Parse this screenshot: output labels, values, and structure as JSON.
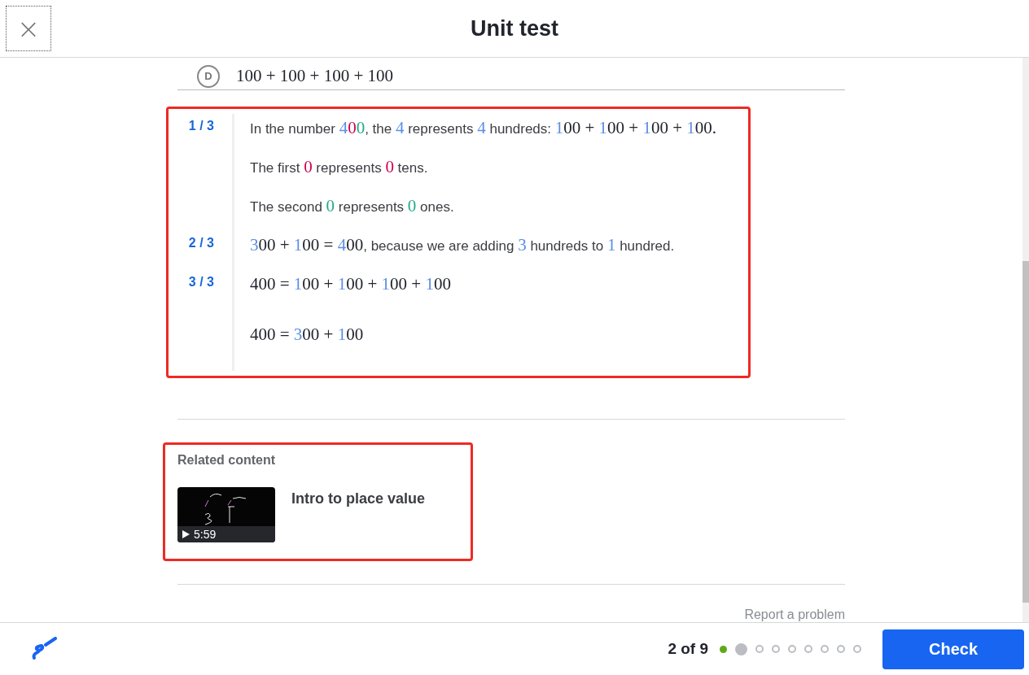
{
  "header": {
    "title": "Unit test",
    "close_button": "×"
  },
  "answer_option": {
    "letter": "D",
    "text": "100 + 100 + 100 + 100"
  },
  "hints": {
    "highlighted": true,
    "steps": [
      {
        "label": "1 / 3",
        "paragraphs": [
          [
            {
              "kind": "prose",
              "text": "In the number "
            },
            {
              "kind": "math",
              "text": "4",
              "color": "#5b8ee6"
            },
            {
              "kind": "math",
              "text": "0",
              "color": "#d1004c"
            },
            {
              "kind": "math",
              "text": "0",
              "color": "#1fab89"
            },
            {
              "kind": "prose",
              "text": ", the "
            },
            {
              "kind": "math",
              "text": "4",
              "color": "#5b8ee6"
            },
            {
              "kind": "prose",
              "text": " represents "
            },
            {
              "kind": "math",
              "text": "4",
              "color": "#5b8ee6"
            },
            {
              "kind": "prose",
              "text": " hundreds: "
            },
            {
              "kind": "math",
              "text": "1",
              "color": "#5b8ee6"
            },
            {
              "kind": "math",
              "text": "00 + "
            },
            {
              "kind": "math",
              "text": "1",
              "color": "#5b8ee6"
            },
            {
              "kind": "math",
              "text": "00 + "
            },
            {
              "kind": "math",
              "text": "1",
              "color": "#5b8ee6"
            },
            {
              "kind": "math",
              "text": "00 + "
            },
            {
              "kind": "math",
              "text": "1",
              "color": "#5b8ee6"
            },
            {
              "kind": "math",
              "text": "00."
            }
          ],
          [
            {
              "kind": "prose",
              "text": "The first "
            },
            {
              "kind": "math",
              "text": "0",
              "color": "#d1004c"
            },
            {
              "kind": "prose",
              "text": " represents "
            },
            {
              "kind": "math",
              "text": "0",
              "color": "#d1004c"
            },
            {
              "kind": "prose",
              "text": " tens."
            }
          ],
          [
            {
              "kind": "prose",
              "text": "The second "
            },
            {
              "kind": "math",
              "text": "0",
              "color": "#1fab89"
            },
            {
              "kind": "prose",
              "text": " represents "
            },
            {
              "kind": "math",
              "text": "0",
              "color": "#1fab89"
            },
            {
              "kind": "prose",
              "text": " ones."
            }
          ]
        ]
      },
      {
        "label": "2 / 3",
        "paragraphs": [
          [
            {
              "kind": "math",
              "text": "3",
              "color": "#5b8ee6"
            },
            {
              "kind": "math",
              "text": "00 + "
            },
            {
              "kind": "math",
              "text": "1",
              "color": "#5b8ee6"
            },
            {
              "kind": "math",
              "text": "00 = "
            },
            {
              "kind": "math",
              "text": "4",
              "color": "#5b8ee6"
            },
            {
              "kind": "math",
              "text": "00"
            },
            {
              "kind": "prose",
              "text": ", because we are adding "
            },
            {
              "kind": "math",
              "text": "3",
              "color": "#5b8ee6"
            },
            {
              "kind": "prose",
              "text": " hundreds to "
            },
            {
              "kind": "math",
              "text": "1",
              "color": "#5b8ee6"
            },
            {
              "kind": "prose",
              "text": " hundred."
            }
          ]
        ]
      },
      {
        "label": "3 / 3",
        "paragraphs": [
          [
            {
              "kind": "math",
              "text": "400 = "
            },
            {
              "kind": "math",
              "text": "1",
              "color": "#5b8ee6"
            },
            {
              "kind": "math",
              "text": "00 + "
            },
            {
              "kind": "math",
              "text": "1",
              "color": "#5b8ee6"
            },
            {
              "kind": "math",
              "text": "00 + "
            },
            {
              "kind": "math",
              "text": "1",
              "color": "#5b8ee6"
            },
            {
              "kind": "math",
              "text": "00 + "
            },
            {
              "kind": "math",
              "text": "1",
              "color": "#5b8ee6"
            },
            {
              "kind": "math",
              "text": "00"
            }
          ],
          [
            {
              "kind": "math",
              "text": "400 = "
            },
            {
              "kind": "math",
              "text": "3",
              "color": "#5b8ee6"
            },
            {
              "kind": "math",
              "text": "00 + "
            },
            {
              "kind": "math",
              "text": "1",
              "color": "#5b8ee6"
            },
            {
              "kind": "math",
              "text": "00"
            }
          ]
        ]
      }
    ]
  },
  "related_content": {
    "highlighted": true,
    "heading": "Related content",
    "items": [
      {
        "title": "Intro to place value",
        "duration": "5:59"
      }
    ]
  },
  "report_link": "Report a problem",
  "footer": {
    "progress_text": "2 of 9",
    "dots": [
      {
        "kind": "done"
      },
      {
        "kind": "current"
      },
      {
        "kind": "pending"
      },
      {
        "kind": "pending"
      },
      {
        "kind": "pending"
      },
      {
        "kind": "pending"
      },
      {
        "kind": "pending"
      },
      {
        "kind": "pending"
      },
      {
        "kind": "pending"
      }
    ],
    "check_button": "Check"
  }
}
